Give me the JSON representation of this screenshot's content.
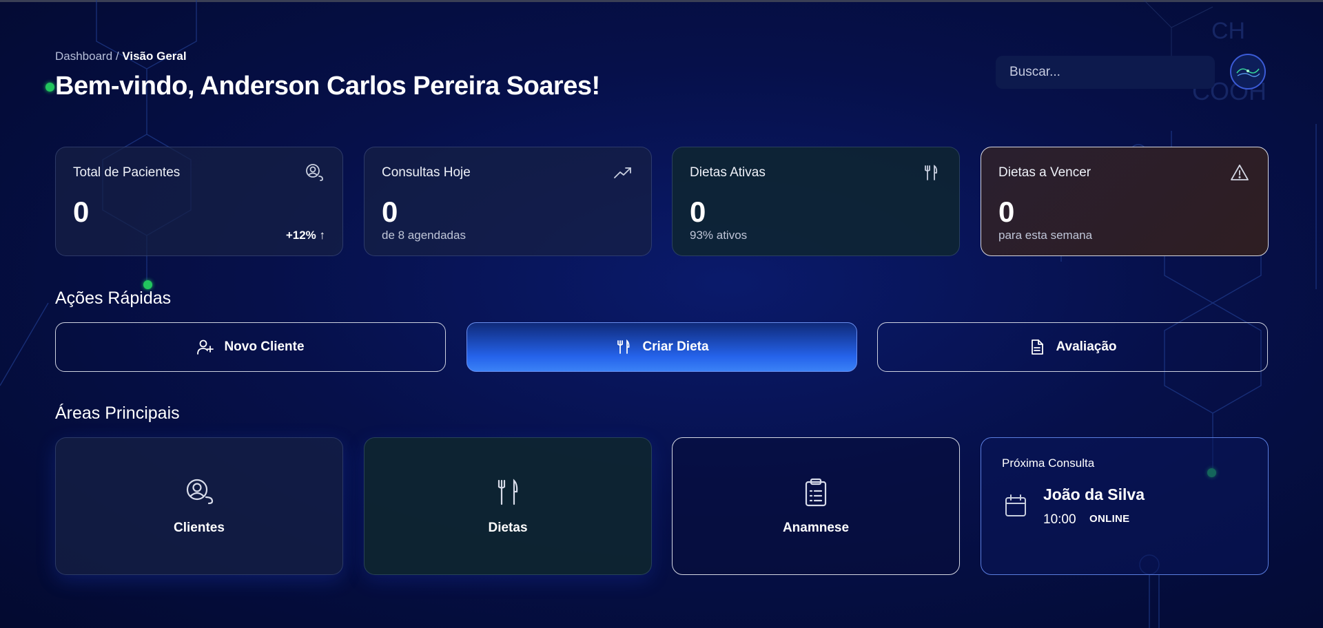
{
  "breadcrumb": {
    "root": "Dashboard",
    "separator": " / ",
    "current": "Visão Geral"
  },
  "header": {
    "title": "Bem-vindo, Anderson Carlos Pereira Soares!"
  },
  "search": {
    "placeholder": "Buscar..."
  },
  "stats": [
    {
      "label": "Total de Pacientes",
      "value": "0",
      "trend": "+12% ↑",
      "icon": "user-circle-icon"
    },
    {
      "label": "Consultas Hoje",
      "value": "0",
      "sub": "de 8 agendadas",
      "icon": "trending-up-icon"
    },
    {
      "label": "Dietas Ativas",
      "value": "0",
      "sub": "93% ativos",
      "icon": "utensils-icon"
    },
    {
      "label": "Dietas a Vencer",
      "value": "0",
      "sub": "para esta semana",
      "icon": "alert-triangle-icon"
    }
  ],
  "quick_actions": {
    "title": "Ações Rápidas",
    "items": [
      {
        "label": "Novo Cliente",
        "icon": "user-plus-icon"
      },
      {
        "label": "Criar Dieta",
        "icon": "utensils-icon"
      },
      {
        "label": "Avaliação",
        "icon": "file-text-icon"
      }
    ]
  },
  "main_areas": {
    "title": "Áreas Principais",
    "items": [
      {
        "label": "Clientes",
        "icon": "user-circle-icon"
      },
      {
        "label": "Dietas",
        "icon": "utensils-icon"
      },
      {
        "label": "Anamnese",
        "icon": "clipboard-list-icon"
      }
    ]
  },
  "next_appointment": {
    "title": "Próxima Consulta",
    "patient": "João da Silva",
    "time": "10:00",
    "mode": "ONLINE",
    "icon": "calendar-icon"
  },
  "background_labels": {
    "ch": "CH",
    "cooh": "COOH"
  },
  "colors": {
    "accent": "#2563eb",
    "status_dot": "#22c55e",
    "warning_card": "#2e1e22",
    "background": "#06104a"
  }
}
